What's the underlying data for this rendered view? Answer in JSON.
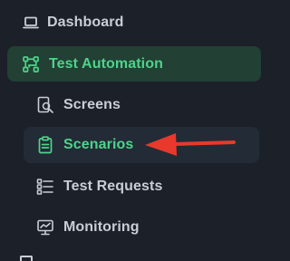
{
  "colors": {
    "background": "#1b2029",
    "accent": "#4ed38a",
    "active_bg": "#232b36",
    "parent_bg": "#224034",
    "arrow": "#e8392c",
    "text": "#c9ced6"
  },
  "sidebar": {
    "dashboard": {
      "label": "Dashboard",
      "icon": "laptop-icon"
    },
    "test_automation": {
      "label": "Test Automation",
      "icon": "workflow-icon"
    },
    "children": [
      {
        "label": "Screens",
        "icon": "screen-search-icon"
      },
      {
        "label": "Scenarios",
        "icon": "clipboard-icon",
        "active": true
      },
      {
        "label": "Test Requests",
        "icon": "checklist-icon"
      },
      {
        "label": "Monitoring",
        "icon": "monitor-icon"
      }
    ]
  },
  "annotation": {
    "type": "arrow",
    "points_to": "Scenarios"
  }
}
